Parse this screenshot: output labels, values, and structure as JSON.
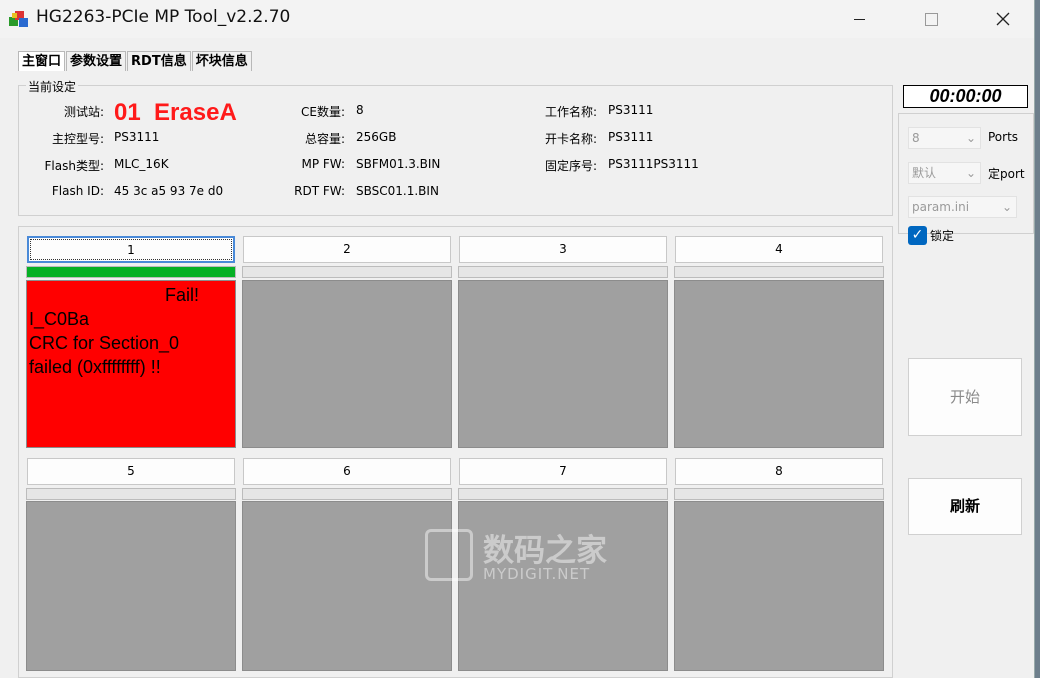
{
  "window": {
    "title": "HG2263-PCIe MP Tool_v2.2.70"
  },
  "tabs": [
    "主窗口",
    "参数设置",
    "RDT信息",
    "坏块信息"
  ],
  "settings": {
    "group_label": "当前设定",
    "station_label": "测试站:",
    "station_num": "01",
    "station_name": "EraseA",
    "controller_label": "主控型号:",
    "controller_value": "PS3111",
    "flash_type_label": "Flash类型:",
    "flash_type_value": "MLC_16K",
    "flash_id_label": "Flash ID:",
    "flash_id_value": "45 3c a5 93 7e d0",
    "ce_label": "CE数量:",
    "ce_value": "8",
    "capacity_label": "总容量:",
    "capacity_value": "256GB",
    "mpfw_label": "MP FW:",
    "mpfw_value": "SBFM01.3.BIN",
    "rdtfw_label": "RDT FW:",
    "rdtfw_value": "SBSC01.1.BIN",
    "work_name_label": "工作名称:",
    "work_name_value": "PS3111",
    "card_name_label": "开卡名称:",
    "card_name_value": "PS3111",
    "fixed_seq_label": "固定序号:",
    "fixed_seq_value": "PS3111PS3111"
  },
  "ports": [
    {
      "label": "1",
      "progress": 1.0,
      "status": "fail",
      "fail_title": "Fail!",
      "fail_lines": [
        "I_C0Ba",
        "CRC for Section_0",
        "failed (0xffffffff) !!"
      ]
    },
    {
      "label": "2",
      "progress": 0,
      "status": "idle"
    },
    {
      "label": "3",
      "progress": 0,
      "status": "idle"
    },
    {
      "label": "4",
      "progress": 0,
      "status": "idle"
    },
    {
      "label": "5",
      "progress": 0,
      "status": "idle"
    },
    {
      "label": "6",
      "progress": 0,
      "status": "idle"
    },
    {
      "label": "7",
      "progress": 0,
      "status": "idle"
    },
    {
      "label": "8",
      "progress": 0,
      "status": "idle"
    }
  ],
  "side": {
    "timer": "00:00:00",
    "ports_value": "8",
    "ports_label": "Ports",
    "fixport_value": "默认",
    "fixport_label": "定port",
    "ini_value": "param.ini",
    "lock_label": "锁定",
    "lock_checked": true,
    "start_label": "开始",
    "refresh_label": "刷新"
  },
  "watermark": {
    "cn": "数码之家",
    "en": "MYDIGIT.NET"
  },
  "colors": {
    "fail": "#ff0000",
    "progress": "#06b025",
    "idle_panel": "#a0a0a0",
    "accent": "#0067c0"
  }
}
